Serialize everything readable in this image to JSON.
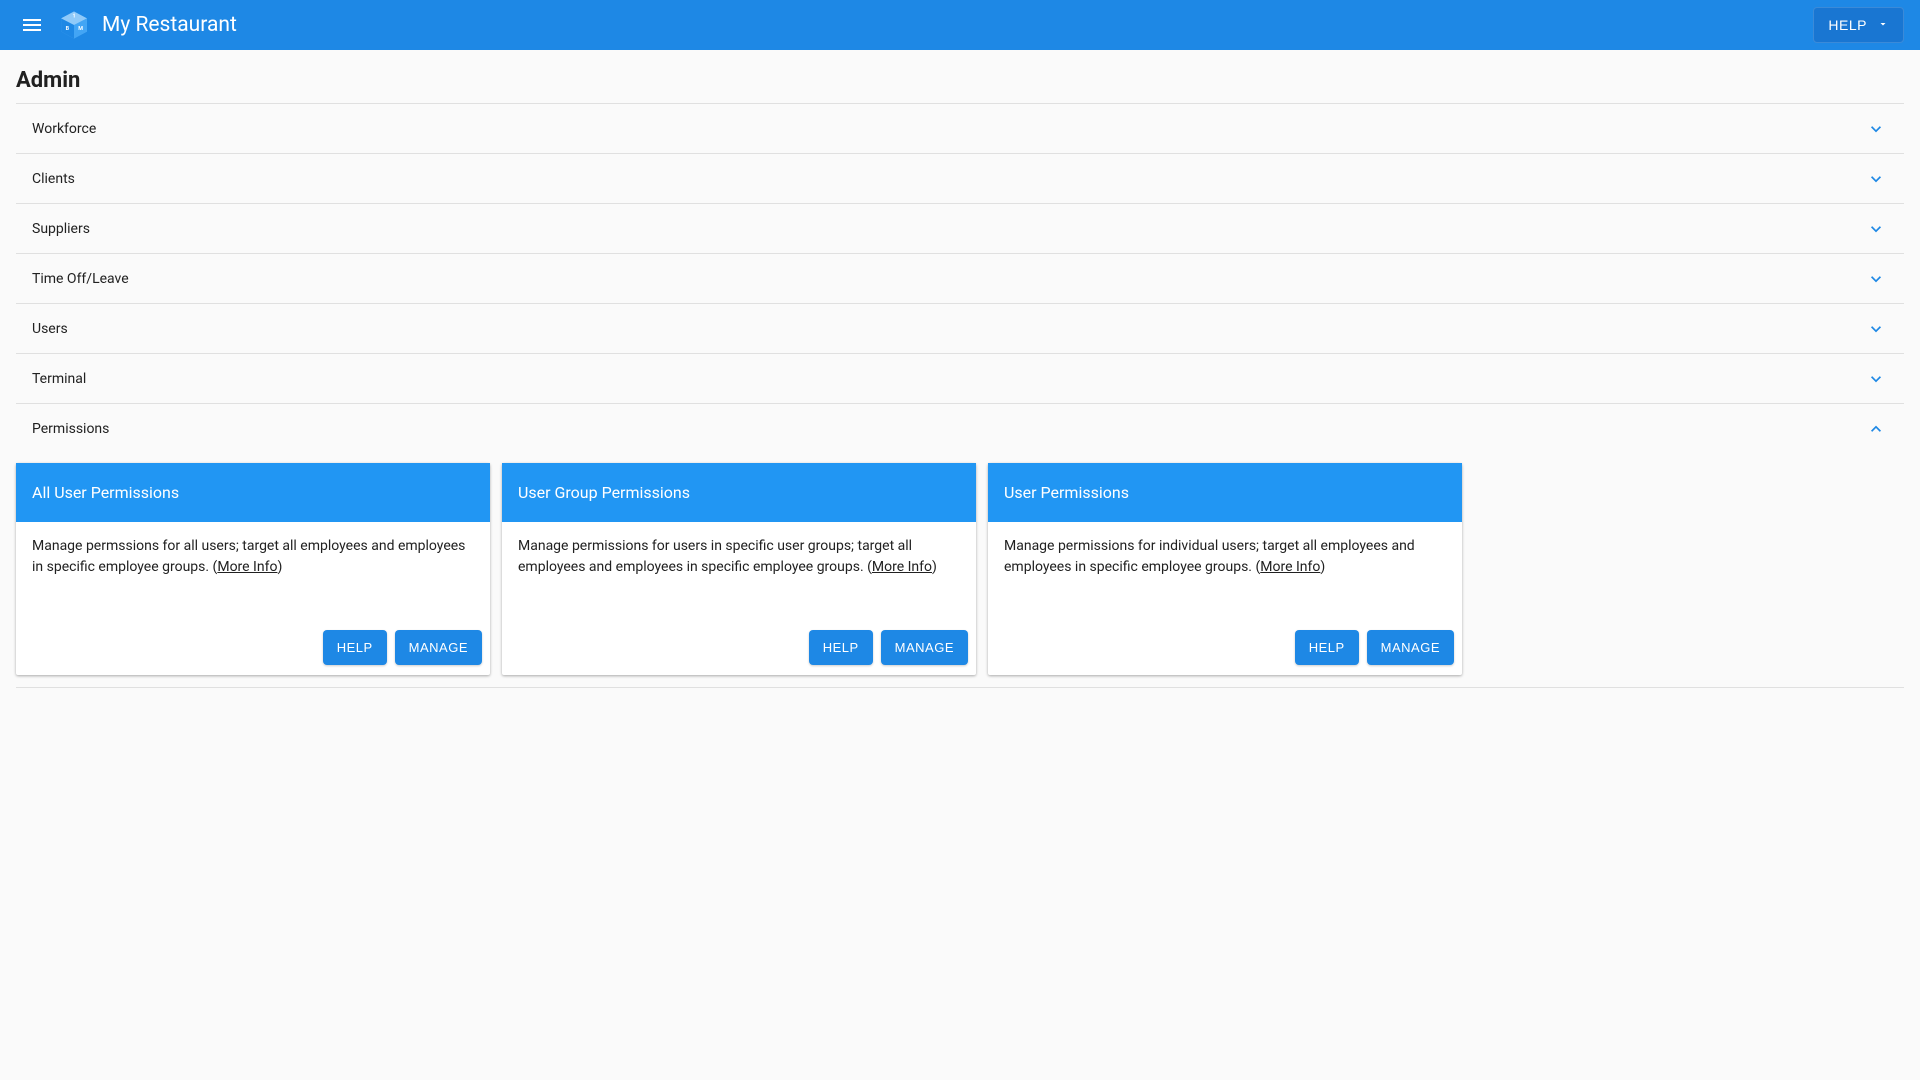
{
  "header": {
    "title": "My Restaurant",
    "help_label": "HELP"
  },
  "page": {
    "title": "Admin"
  },
  "accordion": {
    "items": [
      {
        "label": "Workforce",
        "expanded": false
      },
      {
        "label": "Clients",
        "expanded": false
      },
      {
        "label": "Suppliers",
        "expanded": false
      },
      {
        "label": "Time Off/Leave",
        "expanded": false
      },
      {
        "label": "Users",
        "expanded": false
      },
      {
        "label": "Terminal",
        "expanded": false
      },
      {
        "label": "Permissions",
        "expanded": true
      }
    ]
  },
  "cards": [
    {
      "title": "All User Permissions",
      "desc": "Manage permssions for all users; target all employees and employees in specific employee groups. (",
      "more": "More Info",
      "desc_end": ")",
      "help": "HELP",
      "manage": "MANAGE"
    },
    {
      "title": "User Group Permissions",
      "desc": "Manage permissions for users in specific user groups; target all employees and employees in specific employee groups. (",
      "more": "More Info",
      "desc_end": ")",
      "help": "HELP",
      "manage": "MANAGE"
    },
    {
      "title": "User Permissions",
      "desc": "Manage permissions for individual users; target all employees and employees in specific employee groups. (",
      "more": "More Info",
      "desc_end": ")",
      "help": "HELP",
      "manage": "MANAGE"
    }
  ]
}
